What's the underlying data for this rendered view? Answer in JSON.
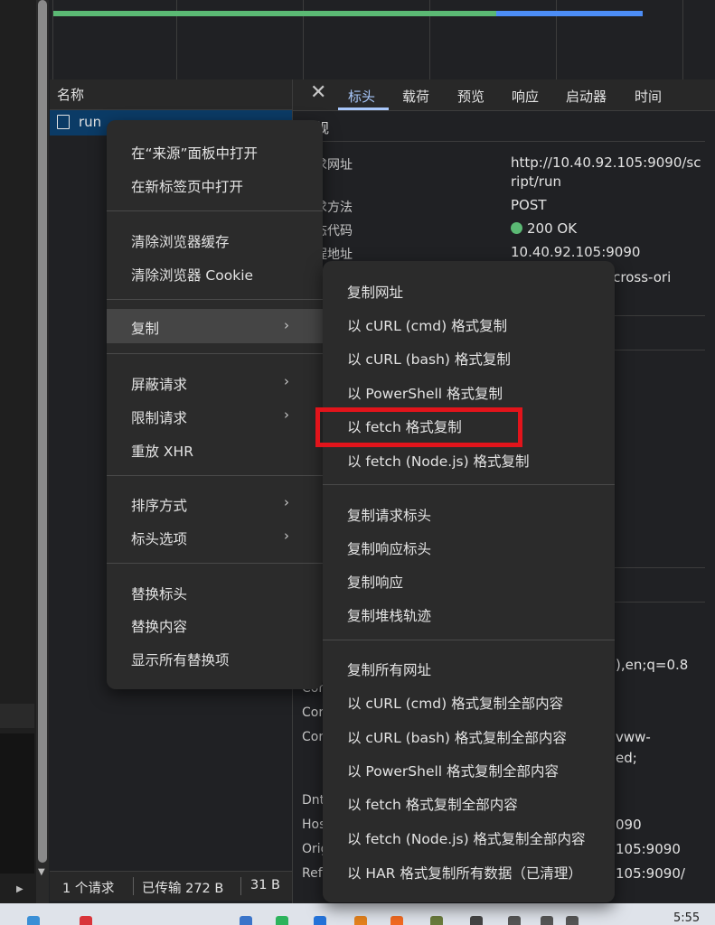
{
  "requests_panel": {
    "header_label": "名称",
    "rows": [
      {
        "name": "run"
      }
    ]
  },
  "details": {
    "tabs": [
      "标头",
      "载荷",
      "预览",
      "响应",
      "启动器",
      "时间"
    ],
    "active_tab": "标头",
    "general_section": "常规",
    "fields": [
      {
        "label": "请求网址",
        "value_lines": [
          "http://10.40.92.105:9090/sc",
          "ript/run"
        ]
      },
      {
        "label": "请求方法",
        "value_lines": [
          "POST"
        ]
      },
      {
        "label": "状态代码",
        "value_lines": [
          "200 OK"
        ]
      },
      {
        "label": "远程地址",
        "value_lines": [
          "10.40.92.105:9090"
        ]
      }
    ],
    "partial_values": {
      "referrer_policy": "en-cross-ori",
      "accept_language": "),en;q=0.8",
      "content_type_1": "vww-",
      "content_type_2": "ed;",
      "host": "090",
      "origin": "105:9090",
      "referer": "105:9090/"
    },
    "partial_labels": [
      "Cor",
      "Cor",
      "Cor",
      "Dnt",
      "Hos",
      "Orig",
      "Ref"
    ]
  },
  "status_bar": {
    "requests": "1 个请求",
    "transferred": "已传输 272 B",
    "size": "31 B"
  },
  "context_menu": {
    "items": [
      {
        "label": "在“来源”面板中打开"
      },
      {
        "label": "在新标签页中打开"
      },
      {
        "label": "清除浏览器缓存"
      },
      {
        "label": "清除浏览器 Cookie"
      },
      {
        "label": "复制",
        "submenu": true,
        "highlighted": true
      },
      {
        "label": "屏蔽请求",
        "submenu": true
      },
      {
        "label": "限制请求",
        "submenu": true
      },
      {
        "label": "重放 XHR"
      },
      {
        "label": "排序方式",
        "submenu": true
      },
      {
        "label": "标头选项",
        "submenu": true
      },
      {
        "label": "替换标头"
      },
      {
        "label": "替换内容"
      },
      {
        "label": "显示所有替换项"
      }
    ]
  },
  "copy_submenu": {
    "items": [
      {
        "label": "复制网址"
      },
      {
        "label": "以 cURL (cmd) 格式复制"
      },
      {
        "label": "以 cURL (bash) 格式复制"
      },
      {
        "label": "以 PowerShell 格式复制"
      },
      {
        "label": "以 fetch 格式复制",
        "outlined": true
      },
      {
        "label": "以 fetch (Node.js) 格式复制"
      },
      {
        "label": "复制请求标头"
      },
      {
        "label": "复制响应标头"
      },
      {
        "label": "复制响应"
      },
      {
        "label": "复制堆栈轨迹"
      },
      {
        "label": "复制所有网址"
      },
      {
        "label": "以 cURL (cmd) 格式复制全部内容"
      },
      {
        "label": "以 cURL (bash) 格式复制全部内容"
      },
      {
        "label": "以 PowerShell 格式复制全部内容"
      },
      {
        "label": "以 fetch 格式复制全部内容"
      },
      {
        "label": "以 fetch (Node.js) 格式复制全部内容"
      },
      {
        "label": "以 HAR 格式复制所有数据（已清理）"
      }
    ]
  },
  "taskbar": {
    "time": "5:55"
  },
  "colors": {
    "accent": "#a8c7fa",
    "status_green": "#5bb974",
    "selection": "#0b3b66",
    "highlight_box": "#e2141b"
  }
}
